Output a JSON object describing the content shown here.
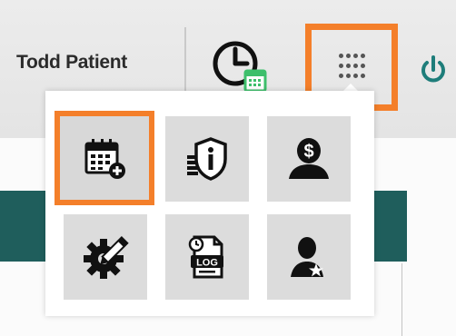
{
  "header": {
    "user_name": "Todd Patient",
    "icons": {
      "clock": "clock-calendar-icon",
      "apps": "apps-grid-icon",
      "power": "power-icon"
    }
  },
  "popup": {
    "tiles": [
      {
        "icon": "add-appointment-icon",
        "selected": true
      },
      {
        "icon": "info-shield-icon",
        "selected": false
      },
      {
        "icon": "billing-user-icon",
        "selected": false
      },
      {
        "icon": "settings-edit-icon",
        "selected": false
      },
      {
        "icon": "log-file-icon",
        "selected": false,
        "text": "LOG"
      },
      {
        "icon": "user-star-icon",
        "selected": false
      }
    ]
  },
  "colors": {
    "highlight": "#f47f2a",
    "teal": "#1f5e5c",
    "clock_badge": "#3dbf6b",
    "power": "#1e7d7a"
  }
}
